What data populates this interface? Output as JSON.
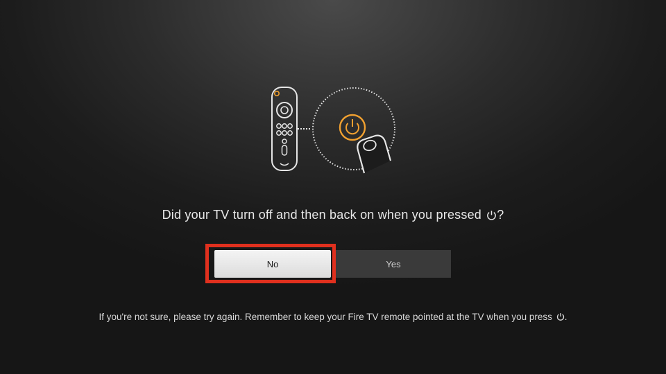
{
  "question": {
    "text": "Did your TV turn off and then back on when you pressed",
    "suffix": "?",
    "icon": "power-icon"
  },
  "buttons": {
    "no_label": "No",
    "yes_label": "Yes",
    "focused": "No"
  },
  "hint": {
    "text": "If you're not sure, please try again. Remember to keep your Fire TV remote pointed at the TV when you press",
    "suffix": ".",
    "icon": "power-icon"
  },
  "illustration": {
    "remote_icon": "fire-tv-remote-icon",
    "power_button_icon": "power-button-icon",
    "finger_icon": "finger-press-icon"
  },
  "colors": {
    "accent": "#f0a030",
    "focus": "#e0301e",
    "background": "#1c1c1c"
  }
}
